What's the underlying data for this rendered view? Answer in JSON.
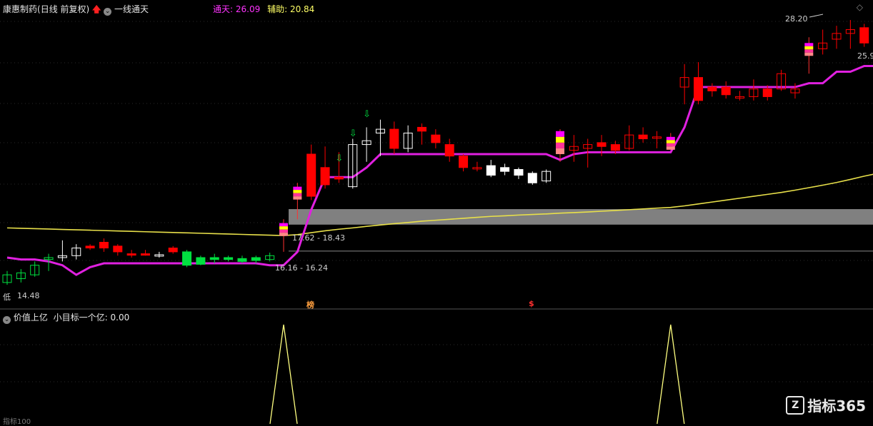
{
  "header": {
    "stock_name": "康惠制药",
    "period": "(日线 前复权)",
    "indicator_name": "一线通天",
    "tong_tian_label": "通天:",
    "tong_tian_value": "26.09",
    "fu_zhu_label": "辅助:",
    "fu_zhu_value": "20.84"
  },
  "labels": {
    "high_price": "28.20",
    "right_price": "25.9",
    "low_price": "14.48",
    "low_prefix": "低",
    "zone_upper": "17.62 - 18.43",
    "zone_lower": "16.16 - 16.24",
    "marker_left": "榜",
    "marker_mid": "$"
  },
  "sub": {
    "title": "价值上亿",
    "line_label": "小目标一个亿:",
    "line_value": "0.00",
    "bottom_tag": "指标100"
  },
  "watermark": {
    "text": "指标365",
    "logo": "Z"
  },
  "icons": [
    "up-arrow-icon",
    "circle-dropdown-icon",
    "diamond-icon"
  ],
  "colors": {
    "up": "#ff0000",
    "down": "#00e040",
    "white": "#ffffff",
    "main_line": "#e020e0",
    "ma_line": "#e8e04a",
    "zone": "#808080",
    "spike": "#ffff80"
  },
  "chart_data": [
    {
      "type": "candlestick",
      "title": "一线通天",
      "series": [
        {
          "name": "candles",
          "values": [
            {
              "o": 14.6,
              "c": 15.0,
              "h": 15.2,
              "l": 14.48,
              "col": "g"
            },
            {
              "o": 14.8,
              "c": 15.1,
              "h": 15.3,
              "l": 14.6,
              "col": "g"
            },
            {
              "o": 15.0,
              "c": 15.5,
              "h": 15.7,
              "l": 14.9,
              "col": "g"
            },
            {
              "o": 15.8,
              "c": 15.9,
              "h": 16.1,
              "l": 15.2,
              "col": "g"
            },
            {
              "o": 15.9,
              "c": 16.0,
              "h": 16.8,
              "l": 15.7,
              "col": "w"
            },
            {
              "o": 16.0,
              "c": 16.4,
              "h": 16.6,
              "l": 15.8,
              "col": "w"
            },
            {
              "o": 16.5,
              "c": 16.4,
              "h": 16.6,
              "l": 16.3,
              "col": "r"
            },
            {
              "o": 16.7,
              "c": 16.4,
              "h": 16.9,
              "l": 16.2,
              "col": "r"
            },
            {
              "o": 16.5,
              "c": 16.2,
              "h": 16.6,
              "l": 16.0,
              "col": "r"
            },
            {
              "o": 16.1,
              "c": 16.05,
              "h": 16.3,
              "l": 15.9,
              "col": "r"
            },
            {
              "o": 16.1,
              "c": 16.05,
              "h": 16.3,
              "l": 16.0,
              "col": "r"
            },
            {
              "o": 16.0,
              "c": 16.05,
              "h": 16.2,
              "l": 15.9,
              "col": "w"
            },
            {
              "o": 16.4,
              "c": 16.2,
              "h": 16.5,
              "l": 16.1,
              "col": "r"
            },
            {
              "o": 16.2,
              "c": 15.5,
              "h": 16.3,
              "l": 15.4,
              "col": "g"
            },
            {
              "o": 15.9,
              "c": 15.55,
              "h": 16.0,
              "l": 15.5,
              "col": "g"
            },
            {
              "o": 15.9,
              "c": 15.8,
              "h": 16.1,
              "l": 15.6,
              "col": "g"
            },
            {
              "o": 15.9,
              "c": 15.8,
              "h": 16.0,
              "l": 15.7,
              "col": "g"
            },
            {
              "o": 15.85,
              "c": 15.7,
              "h": 16.0,
              "l": 15.6,
              "col": "g"
            },
            {
              "o": 15.9,
              "c": 15.75,
              "h": 16.0,
              "l": 15.6,
              "col": "g"
            },
            {
              "o": 15.8,
              "c": 16.0,
              "h": 16.16,
              "l": 15.7,
              "col": "g"
            },
            {
              "o": 17.7,
              "c": 17.6,
              "h": 17.9,
              "l": 16.2,
              "col": "sig"
            },
            {
              "o": 19.2,
              "c": 19.6,
              "h": 19.8,
              "l": 17.9,
              "col": "sig"
            },
            {
              "o": 21.3,
              "c": 19.1,
              "h": 21.8,
              "l": 18.9,
              "col": "r"
            },
            {
              "o": 20.6,
              "c": 19.7,
              "h": 21.7,
              "l": 19.5,
              "col": "r"
            },
            {
              "o": 20.1,
              "c": 20.0,
              "h": 21.4,
              "l": 19.8,
              "col": "r"
            },
            {
              "o": 19.6,
              "c": 21.8,
              "h": 22.1,
              "l": 19.5,
              "col": "w"
            },
            {
              "o": 21.8,
              "c": 22.0,
              "h": 22.7,
              "l": 20.9,
              "col": "w"
            },
            {
              "o": 22.6,
              "c": 22.4,
              "h": 23.1,
              "l": 21.2,
              "col": "w"
            },
            {
              "o": 22.6,
              "c": 21.6,
              "h": 23.0,
              "l": 21.3,
              "col": "r"
            },
            {
              "o": 22.4,
              "c": 21.6,
              "h": 22.8,
              "l": 21.4,
              "col": "w"
            },
            {
              "o": 22.7,
              "c": 22.5,
              "h": 22.9,
              "l": 21.8,
              "col": "r"
            },
            {
              "o": 22.3,
              "c": 21.9,
              "h": 22.6,
              "l": 21.6,
              "col": "r"
            },
            {
              "o": 21.8,
              "c": 21.2,
              "h": 22.1,
              "l": 20.9,
              "col": "r"
            },
            {
              "o": 21.2,
              "c": 20.6,
              "h": 21.3,
              "l": 20.4,
              "col": "r"
            },
            {
              "o": 20.6,
              "c": 20.6,
              "h": 20.9,
              "l": 20.4,
              "col": "r"
            },
            {
              "o": 20.7,
              "c": 20.2,
              "h": 21.0,
              "l": 20.1,
              "col": "wd"
            },
            {
              "o": 20.6,
              "c": 20.4,
              "h": 20.8,
              "l": 20.2,
              "col": "wd"
            },
            {
              "o": 20.5,
              "c": 20.2,
              "h": 20.6,
              "l": 20.0,
              "col": "wd"
            },
            {
              "o": 20.3,
              "c": 19.8,
              "h": 20.4,
              "l": 19.7,
              "col": "wd"
            },
            {
              "o": 19.9,
              "c": 20.4,
              "h": 20.5,
              "l": 19.8,
              "col": "w"
            },
            {
              "o": 22.5,
              "c": 21.3,
              "h": 22.6,
              "l": 20.9,
              "col": "sig"
            },
            {
              "o": 21.5,
              "c": 21.7,
              "h": 22.3,
              "l": 20.9,
              "col": "r"
            },
            {
              "o": 21.6,
              "c": 21.8,
              "h": 22.1,
              "l": 20.6,
              "col": "r"
            },
            {
              "o": 21.9,
              "c": 21.7,
              "h": 22.3,
              "l": 21.2,
              "col": "r"
            },
            {
              "o": 21.8,
              "c": 21.5,
              "h": 22.0,
              "l": 21.3,
              "col": "r"
            },
            {
              "o": 21.6,
              "c": 22.3,
              "h": 22.8,
              "l": 21.5,
              "col": "r"
            },
            {
              "o": 22.3,
              "c": 22.1,
              "h": 22.7,
              "l": 21.9,
              "col": "r"
            },
            {
              "o": 22.2,
              "c": 22.2,
              "h": 22.5,
              "l": 21.6,
              "col": "r"
            },
            {
              "o": 22.2,
              "c": 22.2,
              "h": 22.4,
              "l": 22.0,
              "col": "sig"
            },
            {
              "o": 24.8,
              "c": 25.3,
              "h": 26.0,
              "l": 23.9,
              "col": "r"
            },
            {
              "o": 25.3,
              "c": 24.1,
              "h": 26.1,
              "l": 23.9,
              "col": "r"
            },
            {
              "o": 24.8,
              "c": 24.6,
              "h": 25.0,
              "l": 24.3,
              "col": "r"
            },
            {
              "o": 24.8,
              "c": 24.4,
              "h": 25.1,
              "l": 24.2,
              "col": "r"
            },
            {
              "o": 24.3,
              "c": 24.3,
              "h": 24.6,
              "l": 24.1,
              "col": "r"
            },
            {
              "o": 24.3,
              "c": 24.7,
              "h": 25.2,
              "l": 24.1,
              "col": "r"
            },
            {
              "o": 24.7,
              "c": 24.3,
              "h": 24.9,
              "l": 24.1,
              "col": "r"
            },
            {
              "o": 24.7,
              "c": 25.5,
              "h": 25.7,
              "l": 24.6,
              "col": "r"
            },
            {
              "o": 24.5,
              "c": 24.7,
              "h": 25.0,
              "l": 24.2,
              "col": "r"
            },
            {
              "o": 26.6,
              "c": 27.1,
              "h": 27.4,
              "l": 25.5,
              "col": "sig"
            },
            {
              "o": 26.8,
              "c": 27.1,
              "h": 27.8,
              "l": 26.5,
              "col": "r"
            },
            {
              "o": 27.3,
              "c": 27.6,
              "h": 28.0,
              "l": 26.8,
              "col": "r"
            },
            {
              "o": 27.6,
              "c": 27.8,
              "h": 28.3,
              "l": 26.8,
              "col": "r"
            },
            {
              "o": 27.9,
              "c": 27.1,
              "h": 28.1,
              "l": 26.9,
              "col": "r"
            },
            {
              "o": 26.7,
              "c": 26.2,
              "h": 26.9,
              "l": 25.8,
              "col": "r"
            },
            {
              "o": 25.5,
              "c": 24.0,
              "h": 25.8,
              "l": 23.6,
              "col": "r"
            }
          ]
        },
        {
          "name": "通天",
          "values": [
            15.9,
            15.8,
            15.8,
            15.7,
            15.5,
            15.0,
            15.4,
            15.6,
            15.6,
            15.6,
            15.6,
            15.6,
            15.6,
            15.6,
            15.6,
            15.6,
            15.6,
            15.6,
            15.6,
            15.5,
            15.5,
            16.2,
            18.4,
            20.1,
            20.1,
            20.1,
            20.6,
            21.3,
            21.3,
            21.3,
            21.3,
            21.3,
            21.3,
            21.3,
            21.3,
            21.3,
            21.3,
            21.3,
            21.3,
            21.3,
            21.0,
            21.3,
            21.4,
            21.4,
            21.4,
            21.4,
            21.4,
            21.4,
            21.4,
            22.7,
            24.8,
            24.8,
            24.8,
            24.8,
            24.8,
            24.8,
            24.8,
            24.8,
            25.0,
            25.0,
            25.6,
            25.6,
            25.9,
            25.9,
            25.9
          ]
        },
        {
          "name": "辅助",
          "values": [
            17.45,
            17.43,
            17.41,
            17.39,
            17.37,
            17.35,
            17.33,
            17.31,
            17.29,
            17.27,
            17.25,
            17.23,
            17.21,
            17.19,
            17.17,
            17.15,
            17.13,
            17.11,
            17.09,
            17.07,
            17.05,
            17.1,
            17.2,
            17.3,
            17.38,
            17.45,
            17.53,
            17.6,
            17.67,
            17.73,
            17.8,
            17.85,
            17.9,
            17.95,
            18.0,
            18.05,
            18.08,
            18.12,
            18.15,
            18.18,
            18.22,
            18.25,
            18.28,
            18.32,
            18.36,
            18.4,
            18.44,
            18.48,
            18.52,
            18.6,
            18.7,
            18.8,
            18.9,
            19.0,
            19.1,
            19.2,
            19.3,
            19.42,
            19.55,
            19.68,
            19.82,
            19.98,
            20.15,
            20.3,
            20.45
          ]
        }
      ],
      "zones": [
        {
          "label": "17.62 - 18.43",
          "low": 17.62,
          "high": 18.43
        },
        {
          "label": "16.16 - 16.24",
          "low": 16.16,
          "high": 16.24
        }
      ],
      "ylim": [
        14.0,
        28.6
      ]
    },
    {
      "type": "line",
      "title": "价值上亿",
      "series": [
        {
          "name": "小目标一个亿",
          "spikes_at": [
            20,
            48
          ],
          "peak": 1.0,
          "baseline": 0.0
        }
      ],
      "ylim": [
        0,
        1
      ]
    }
  ]
}
